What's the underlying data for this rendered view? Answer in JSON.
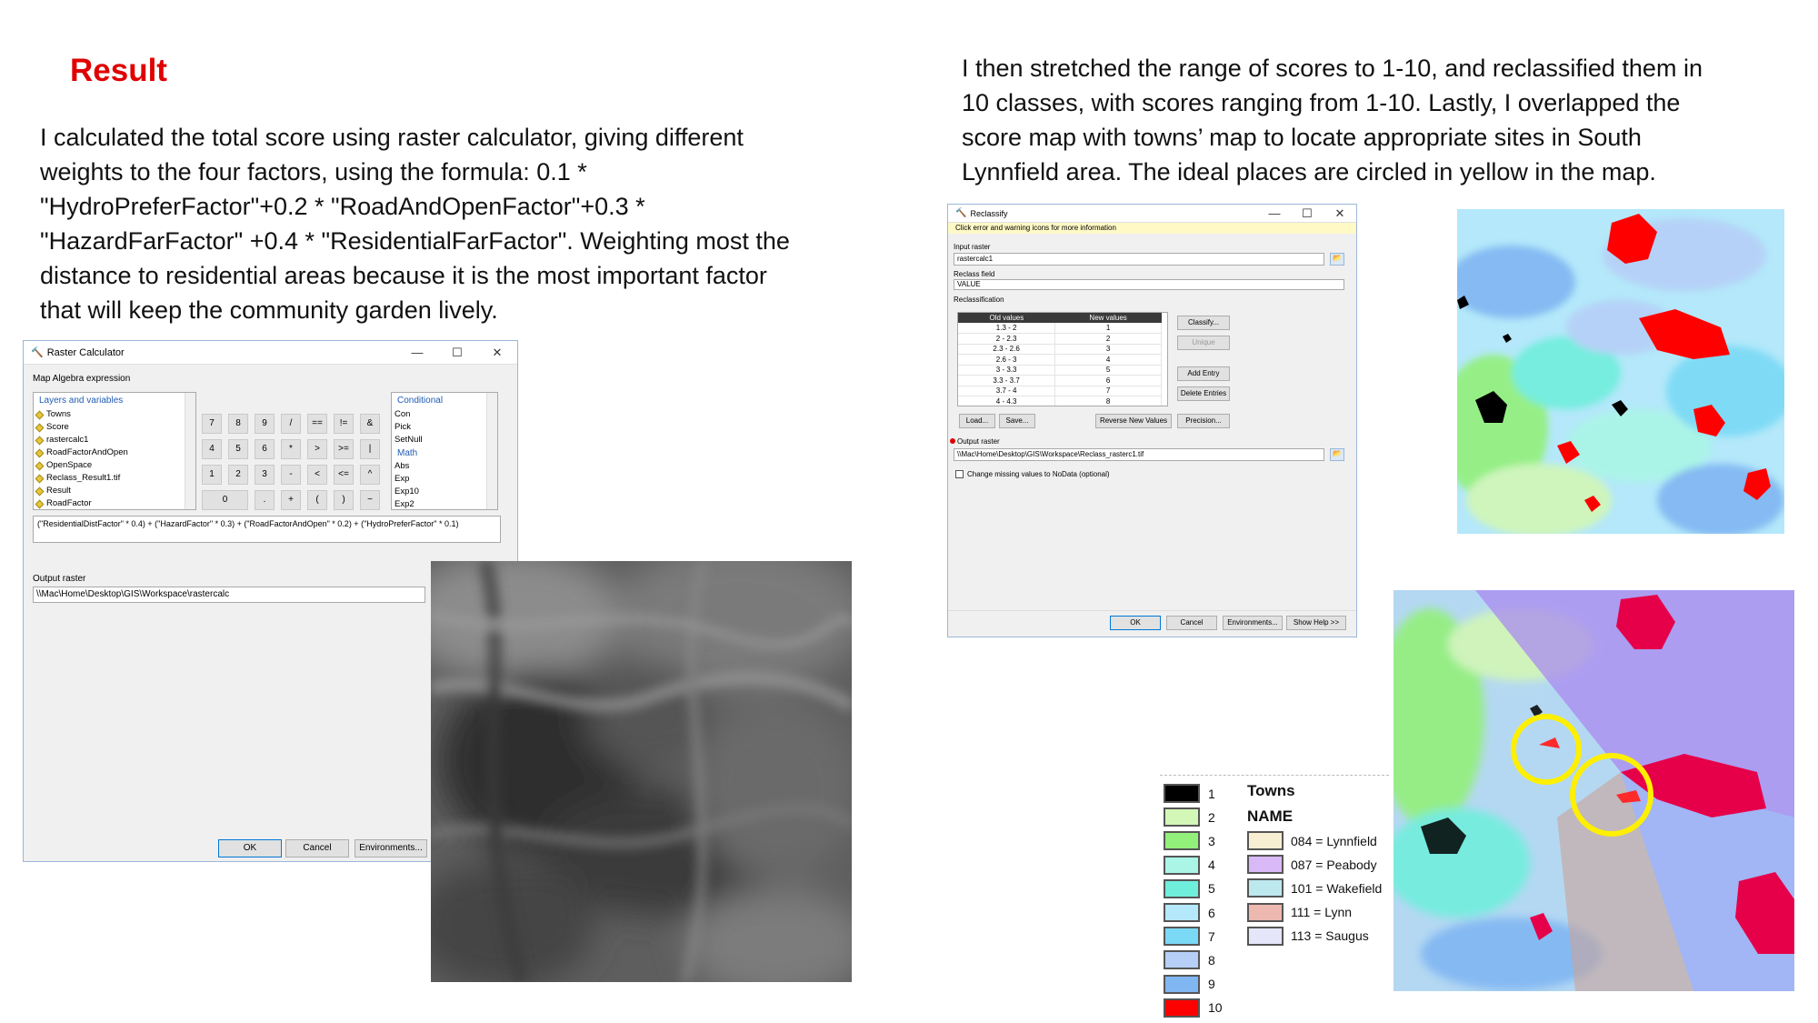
{
  "heading": "Result",
  "paragraph_left": "I calculated the total score using raster calculator, giving different\nweights to the four factors, using the formula: 0.1 *\n\"HydroPreferFactor\"+0.2 * \"RoadAndOpenFactor\"+0.3 *\n\"HazardFarFactor\" +0.4 * \"ResidentialFarFactor\". Weighting most the\ndistance to residential areas because it is the most important factor\nthat will keep the community garden lively.",
  "paragraph_right": "I then stretched the range of scores to 1-10, and reclassified them in\n10 classes, with scores ranging from 1-10. Lastly, I overlapped the\nscore map with towns’ map to locate appropriate sites in South\nLynnfield area. The ideal places are circled in yellow in the map.",
  "raster_calculator": {
    "title": "Raster Calculator",
    "window_buttons": [
      "—",
      "☐",
      "✕"
    ],
    "map_algebra_label": "Map Algebra expression",
    "layers_header": "Layers and variables",
    "layers": [
      "Towns",
      "Score",
      "rastercalc1",
      "RoadFactorAndOpen",
      "OpenSpace",
      "Reclass_Result1.tif",
      "Result",
      "RoadFactor"
    ],
    "keypad": [
      "7",
      "8",
      "9",
      "/",
      "==",
      "!=",
      "&",
      "4",
      "5",
      "6",
      "*",
      ">",
      ">=",
      "|",
      "1",
      "2",
      "3",
      "-",
      "<",
      "<=",
      "^",
      "0",
      ".",
      "+",
      "(",
      ")",
      "~"
    ],
    "conditional_header": "Conditional",
    "conditional_items": [
      "Con",
      "Pick",
      "SetNull"
    ],
    "math_header": "Math",
    "math_items": [
      "Abs",
      "Exp",
      "Exp10",
      "Exp2"
    ],
    "expression": "(\"ResidentialDistFactor\" * 0.4) + (\"HazardFactor\" * 0.3) + (\"RoadFactorAndOpen\" * 0.2) + (\"HydroPreferFactor\" * 0.1)",
    "output_label": "Output raster",
    "output_value": "\\\\Mac\\Home\\Desktop\\GIS\\Workspace\\rastercalc",
    "ok_label": "OK",
    "cancel_label": "Cancel",
    "environments_label": "Environments..."
  },
  "reclassify": {
    "title": "Reclassify",
    "window_buttons": [
      "—",
      "☐",
      "✕"
    ],
    "info_bar": "Click error and warning icons for more information",
    "input_label": "Input raster",
    "input_value": "rastercalc1",
    "reclass_field_label": "Reclass field",
    "reclass_field_value": "VALUE",
    "reclassification_label": "Reclassification",
    "col_old": "Old values",
    "col_new": "New values",
    "rows": [
      {
        "old": "1.3 - 2",
        "new": "1"
      },
      {
        "old": "2 - 2.3",
        "new": "2"
      },
      {
        "old": "2.3 - 2.6",
        "new": "3"
      },
      {
        "old": "2.6 - 3",
        "new": "4"
      },
      {
        "old": "3 - 3.3",
        "new": "5"
      },
      {
        "old": "3.3 - 3.7",
        "new": "6"
      },
      {
        "old": "3.7 - 4",
        "new": "7"
      },
      {
        "old": "4 - 4.3",
        "new": "8"
      }
    ],
    "classify_label": "Classify...",
    "unique_label": "Unique",
    "add_entry_label": "Add Entry",
    "delete_entries_label": "Delete Entries",
    "load_label": "Load...",
    "save_label": "Save...",
    "reverse_label": "Reverse New Values",
    "precision_label": "Precision...",
    "output_label": "Output raster",
    "output_value": "\\\\Mac\\Home\\Desktop\\GIS\\Workspace\\Reclass_rasterc1.tif",
    "nodata_label": "Change missing values to NoData (optional)",
    "ok_label": "OK",
    "cancel_label": "Cancel",
    "environments_label": "Environments...",
    "help_label": "Show Help >>"
  },
  "legend": {
    "classes": [
      {
        "label": "1",
        "color": "#000000"
      },
      {
        "label": "2",
        "color": "#d2f7b6"
      },
      {
        "label": "3",
        "color": "#93f07a"
      },
      {
        "label": "4",
        "color": "#aaf5e6"
      },
      {
        "label": "5",
        "color": "#6feedc"
      },
      {
        "label": "6",
        "color": "#b4e8fa"
      },
      {
        "label": "7",
        "color": "#7ad9f5"
      },
      {
        "label": "8",
        "color": "#b6cff7"
      },
      {
        "label": "9",
        "color": "#80b6f2"
      },
      {
        "label": "10",
        "color": "#ff0000"
      }
    ],
    "towns_title": "Towns",
    "name_title": "NAME",
    "towns": [
      {
        "label": "084 = Lynnfield",
        "color": "#f7efd2"
      },
      {
        "label": "087 = Peabody",
        "color": "#d9b8f7"
      },
      {
        "label": "101 = Wakefield",
        "color": "#bde8ee"
      },
      {
        "label": "111 = Lynn",
        "color": "#ecb8b0"
      },
      {
        "label": "113 = Saugus",
        "color": "#e6e6fa"
      }
    ]
  }
}
